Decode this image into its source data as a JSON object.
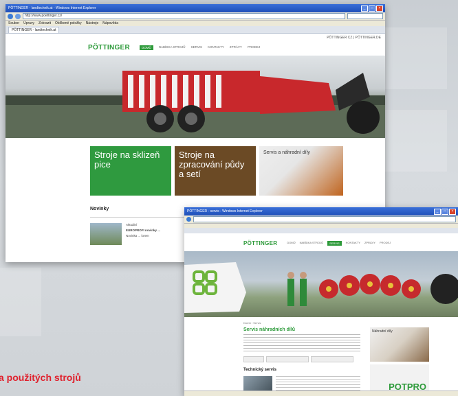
{
  "window1": {
    "title": "PÖTTINGER - landtechnik.at - Windows Internet Explorer",
    "address": "http://www.poettinger.cz/",
    "menu": [
      "Soubor",
      "Úpravy",
      "Zobrazit",
      "Oblíbené položky",
      "Nástroje",
      "Nápověda"
    ],
    "favorites_label": "Oblíbené položky",
    "tab_label": "PÖTTINGER - landtechnik.at",
    "toplinks": "PÖTTINGER CZ  |  PÖTTINGER.DE",
    "logo": "PÖTTINGER",
    "nav": [
      "DOMŮ",
      "NABÍDKA STROJŮ",
      "SERVIS",
      "KONTAKTY",
      "ZPRÁVY",
      "PRODEJ"
    ],
    "active_nav": 0,
    "tiles": [
      {
        "text": "Stroje na sklizeň pice",
        "color": "#2f9a3f"
      },
      {
        "text": "Stroje na zpracování půdy a setí",
        "color": "#6b4a25"
      },
      {
        "text": "Servis a náhradní díly",
        "color": "#c0641e"
      }
    ],
    "news_heading": "Novinky",
    "news_title": "Aktuální",
    "news_subtitle": "EUROPROFI novinky ...",
    "news_body": "Novinka ... lorem"
  },
  "window2": {
    "title": "PÖTTINGER - servis - Windows Internet Explorer",
    "logo": "PÖTTINGER",
    "nav": [
      "DOMŮ",
      "NABÍDKA STROJŮ",
      "SERVIS",
      "KONTAKTY",
      "ZPRÁVY",
      "PRODEJ"
    ],
    "active_nav": 2,
    "breadcrumb": "Domů › Servis",
    "page_heading": "Servis náhradních dílů",
    "section_heading": "Technický servis",
    "side_box_label": "Náhradní díly",
    "potpro_logo": "POTPRO"
  },
  "caption": "a použitých strojů"
}
